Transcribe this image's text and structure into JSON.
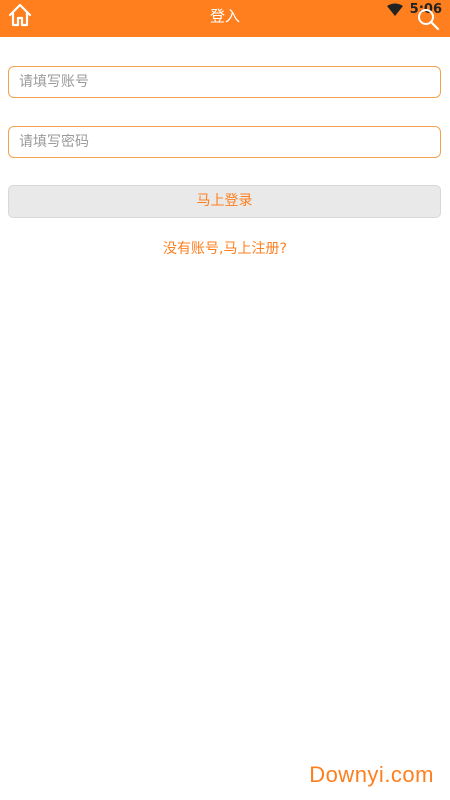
{
  "header": {
    "title": "登入",
    "home_icon": "home-icon",
    "search_icon": "search-icon",
    "background": "#ff7f1e"
  },
  "status_bar": {
    "time": "5:06",
    "wifi_icon": "wifi-icon"
  },
  "form": {
    "account_placeholder": "请填写账号",
    "password_placeholder": "请填写密码",
    "login_label": "马上登录",
    "register_text": "没有账号,马上注册?"
  },
  "colors": {
    "accent": "#ff7f1e",
    "input_border": "#f3a34e",
    "button_bg": "#e9e9e9"
  },
  "watermark": {
    "text": "Downyi.com"
  }
}
